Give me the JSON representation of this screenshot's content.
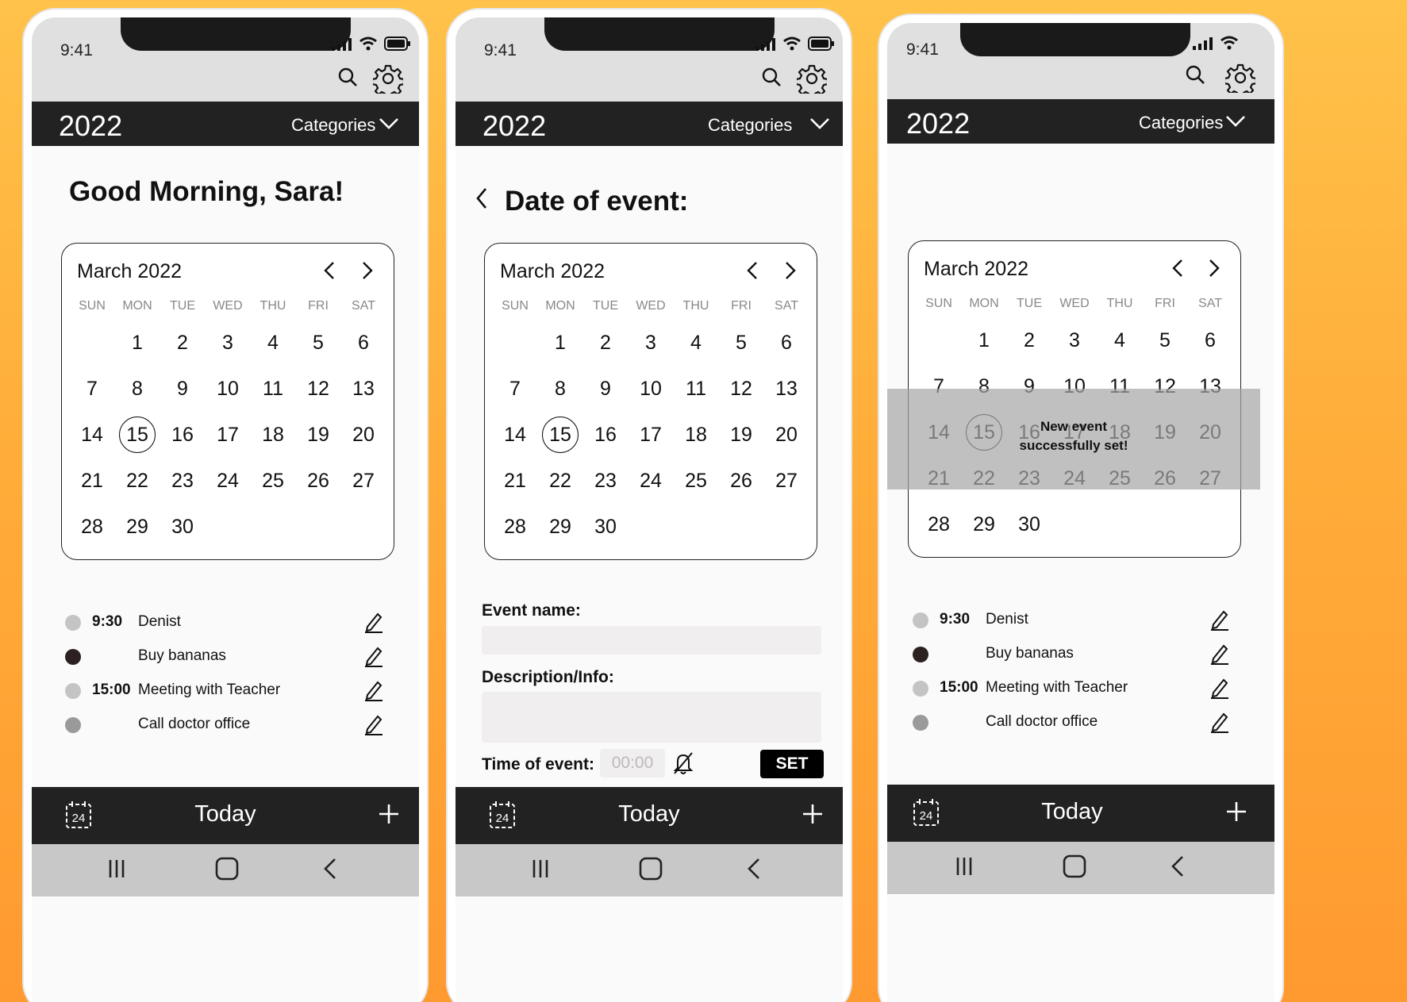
{
  "status": {
    "time": "9:41"
  },
  "header": {
    "year": "2022",
    "categories_label": "Categories"
  },
  "calendar": {
    "month_label": "March 2022",
    "weekdays": [
      "SUN",
      "MON",
      "TUE",
      "WED",
      "THU",
      "FRI",
      "SAT"
    ],
    "days": [
      "1",
      "2",
      "3",
      "4",
      "5",
      "6",
      "7",
      "8",
      "9",
      "10",
      "11",
      "12",
      "13",
      "14",
      "15",
      "16",
      "17",
      "18",
      "19",
      "20",
      "21",
      "22",
      "23",
      "24",
      "25",
      "26",
      "27",
      "28",
      "29",
      "30"
    ],
    "selected_day": "15"
  },
  "screen1": {
    "greeting": "Good Morning, Sara!"
  },
  "screen2": {
    "title": "Date of event:",
    "event_name_label": "Event name:",
    "description_label": "Description/Info:",
    "time_label": "Time of event:",
    "time_placeholder": "00:00",
    "set_label": "SET"
  },
  "screen3": {
    "toast_line1": "New event",
    "toast_line2": "successfully set!"
  },
  "events": [
    {
      "time": "9:30",
      "name": "Denist",
      "dot_color": "#c4c4c4"
    },
    {
      "time": "",
      "name": "Buy bananas",
      "dot_color": "#2b2121"
    },
    {
      "time": "15:00",
      "name": "Meeting with Teacher",
      "dot_color": "#c4c4c4"
    },
    {
      "time": "",
      "name": "Call doctor office",
      "dot_color": "#9a9a9a"
    }
  ],
  "bottom": {
    "today_label": "Today",
    "calendar_icon_text": "24"
  }
}
